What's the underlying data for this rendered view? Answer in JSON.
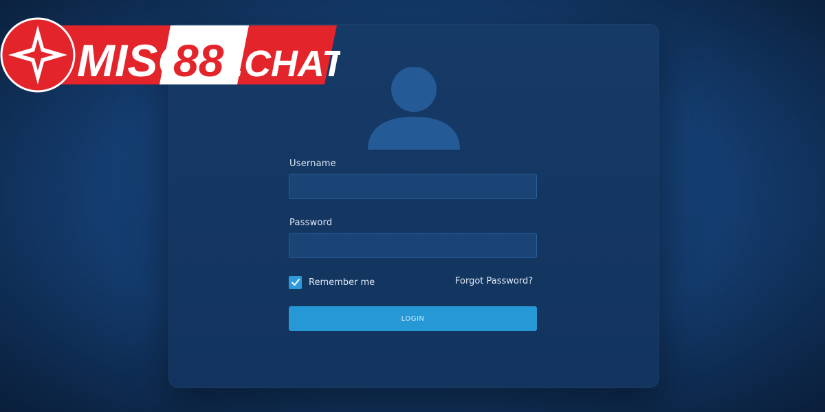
{
  "brand": {
    "logo_text": "MISO88.CHAT",
    "word_miso": "MISO",
    "word_88": "88",
    "word_chat": ".CHAT",
    "red": "#e4242b",
    "white": "#ffffff",
    "icon": "star-icon"
  },
  "login_form": {
    "avatar_icon": "user-icon",
    "username_label": "Username",
    "username_value": "",
    "password_label": "Password",
    "password_value": "",
    "remember_label": "Remember me",
    "remember_checked": true,
    "forgot_label": "Forgot Password?",
    "login_label": "LOGIN",
    "accent": "#2798d6"
  }
}
